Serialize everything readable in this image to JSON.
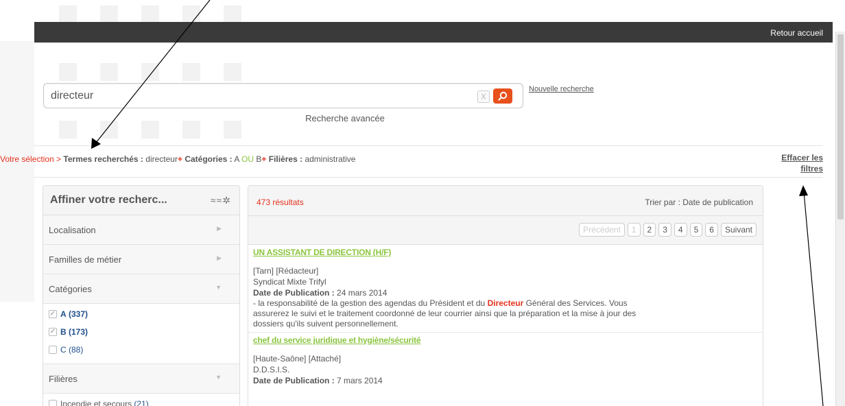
{
  "header": {
    "home_link": "Retour accueil"
  },
  "search": {
    "value": "directeur",
    "clear_label": "X",
    "new_search": "Nouvelle recherche",
    "advanced": "Recherche avancée"
  },
  "selection": {
    "label": "Votre sélection >",
    "terms_label": "Termes recherchés :",
    "terms_value": "directeur",
    "plus": "+",
    "categories_label": "Catégories :",
    "cat_a": "A",
    "ou": "OU",
    "cat_b": "B",
    "filieres_label": "Filières :",
    "filieres_value": "administrative",
    "clear_filters_1": "Effacer les",
    "clear_filters_2": "filtres"
  },
  "sidebar": {
    "title": "Affiner votre recherc...",
    "icons": "≈≈✲",
    "facets": {
      "localisation": "Localisation",
      "familles": "Familles de métier",
      "categories": "Catégories",
      "filieres": "Filières"
    },
    "categories": [
      {
        "name": "A",
        "count": "(337)",
        "checked": true
      },
      {
        "name": "B",
        "count": "(173)",
        "checked": true
      },
      {
        "name": "C",
        "count": "(88)",
        "checked": false
      }
    ],
    "filieres": [
      {
        "name": "Incendie et secours",
        "count": "(21)",
        "checked": false
      }
    ]
  },
  "results": {
    "count": "473 résultats",
    "sort": "Trier par : Date de publication",
    "pager": {
      "prev": "Précédent",
      "pages": [
        "1",
        "2",
        "3",
        "4",
        "5",
        "6"
      ],
      "next": "Suivant"
    },
    "items": [
      {
        "title": "UN ASSISTANT DE DIRECTION (H/F)",
        "tags": "[Tarn]  [Rédacteur]",
        "org": "Syndicat Mixte Trifyl",
        "date_label": "Date de Publication :",
        "date": "24 mars 2014",
        "desc_before": "- la responsabilité de la gestion des agendas du Président et du ",
        "desc_hl": "Directeur",
        "desc_after": " Général des Services. Vous assurerez le suivi et le traitement coordonné de leur courrier ainsi que la préparation et la mise à jour des dossiers qu'ils suivent personnellement."
      },
      {
        "title": "chef du service juridique et hygiène/sécurité",
        "tags": "[Haute-Saône]  [Attaché]",
        "org": "D.D.S.I.S.",
        "date_label": "Date de Publication :",
        "date": "7 mars 2014"
      }
    ]
  }
}
